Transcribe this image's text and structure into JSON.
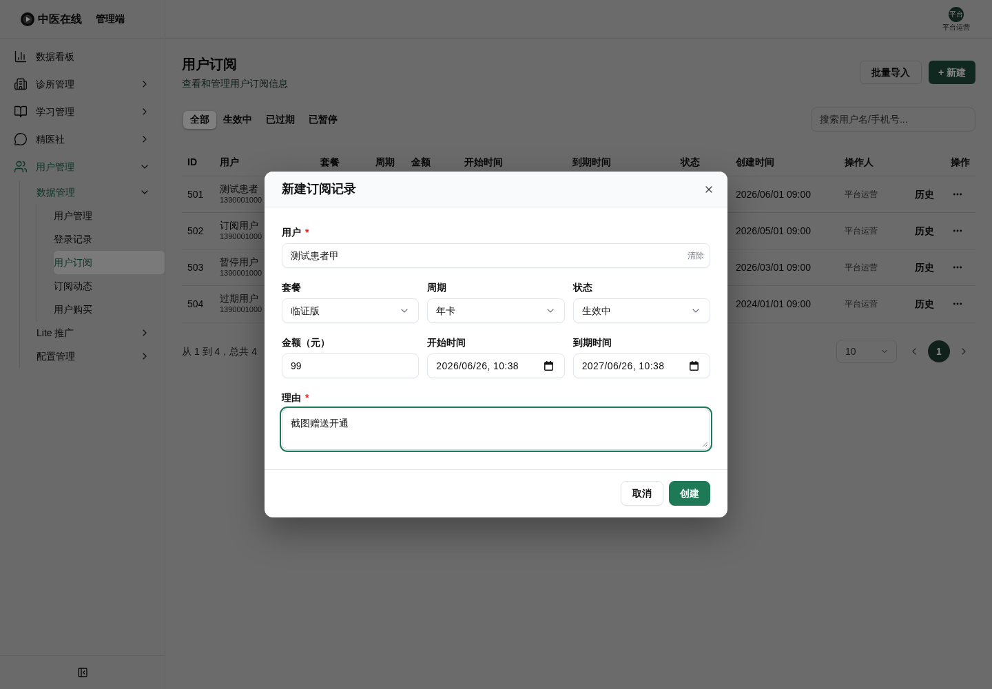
{
  "sidebar": {
    "brand": {
      "name": "中医在线",
      "tag": "管理端"
    },
    "items": [
      {
        "label": "数据看板",
        "selected": false
      },
      {
        "label": "诊所管理",
        "selected": false,
        "expanded": false
      },
      {
        "label": "学习管理",
        "selected": false,
        "expanded": false
      },
      {
        "label": "精医社",
        "selected": false,
        "expanded": false
      },
      {
        "label": "用户管理",
        "selected": false,
        "expanded": true,
        "children": [
          {
            "label": "数据管理",
            "selected": false,
            "expanded": true,
            "children": [
              {
                "label": "用户管理",
                "selected": false
              },
              {
                "label": "登录记录",
                "selected": false
              },
              {
                "label": "用户订阅",
                "selected": true
              },
              {
                "label": "订阅动态",
                "selected": false
              },
              {
                "label": "用户购买",
                "selected": false
              }
            ]
          },
          {
            "label": "Lite 推广",
            "selected": false,
            "expanded": false
          },
          {
            "label": "配置管理",
            "selected": false,
            "expanded": false
          }
        ]
      }
    ]
  },
  "top_bar": {
    "user": {
      "avatar_text": "平台",
      "name": "平台运营"
    }
  },
  "page": {
    "title": "用户订阅",
    "subtitle": "查看和管理用户订阅信息",
    "actions": [
      {
        "label": "批量导入",
        "kind": "secondary"
      },
      {
        "label": "+ 新建",
        "kind": "primary"
      }
    ]
  },
  "filter_tabs": [
    {
      "label": "全部",
      "selected": true
    },
    {
      "label": "生效中",
      "selected": false
    },
    {
      "label": "已过期",
      "selected": false
    },
    {
      "label": "已暂停",
      "selected": false
    }
  ],
  "search": {
    "placeholder": "搜索用户名/手机号..."
  },
  "table": {
    "columns": [
      "ID",
      "用户",
      "套餐",
      "周期",
      "金额",
      "开始时间",
      "到期时间",
      "状态",
      "创建时间",
      "操作人",
      "操作"
    ],
    "rows": [
      {
        "id": "501",
        "user_name": "测试患者",
        "user_phone": "1390001000",
        "created_at": "2026/06/01 09:00",
        "operator": "平台运营",
        "action": "历史"
      },
      {
        "id": "502",
        "user_name": "订阅用户",
        "user_phone": "1390001000",
        "created_at": "2026/05/01 09:00",
        "operator": "平台运营",
        "action": "历史"
      },
      {
        "id": "503",
        "user_name": "暂停用户",
        "user_phone": "1390001000",
        "created_at": "2026/03/01 09:00",
        "operator": "平台运营",
        "action": "历史"
      },
      {
        "id": "504",
        "user_name": "过期用户",
        "user_phone": "1390001000",
        "created_at": "2024/01/01 09:00",
        "operator": "平台运营",
        "action": "历史"
      }
    ]
  },
  "pagination": {
    "summary": "从 1 到 4，总共 4",
    "page_size": "10",
    "pages": [
      {
        "label": "1",
        "selected": true
      }
    ]
  },
  "dialog": {
    "title": "新建订阅记录",
    "form_rows": [
      [
        {
          "kind": "search",
          "label": "用户",
          "required_mark": "*",
          "value": "测试患者甲",
          "clear_label": "清除",
          "focused": false
        }
      ],
      [
        {
          "kind": "select",
          "label": "套餐",
          "value": "临证版",
          "focused": false
        },
        {
          "kind": "select",
          "label": "周期",
          "value": "年卡",
          "focused": false
        },
        {
          "kind": "select",
          "label": "状态",
          "value": "生效中",
          "focused": false
        }
      ],
      [
        {
          "kind": "text",
          "label": "金额（元）",
          "value": "99",
          "focused": false
        },
        {
          "kind": "datetime",
          "label": "开始时间",
          "value": "2026/06/26, 10:38",
          "focused": false
        },
        {
          "kind": "datetime",
          "label": "到期时间",
          "value": "2027/06/26, 10:38",
          "focused": false
        }
      ],
      [
        {
          "kind": "textarea",
          "label": "理由",
          "required_mark": "*",
          "value": "截图赠送开通",
          "focused": true
        }
      ]
    ],
    "buttons": [
      {
        "label": "取消",
        "kind": "secondary"
      },
      {
        "label": "创建",
        "kind": "primary"
      }
    ]
  }
}
